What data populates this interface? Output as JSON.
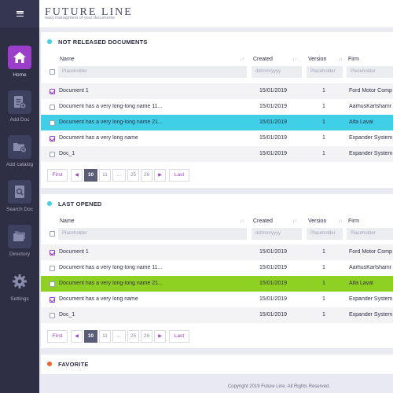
{
  "app": {
    "brand": "FUTURE LINE",
    "tagline": "easy managment of your documents"
  },
  "colors": {
    "sidebar": "#2e2f45",
    "accent": "#9b3ec9",
    "row_highlight_cyan": "#3fd0e8",
    "row_highlight_green": "#8fd123",
    "dot_cyan": "#3fd0e8",
    "dot_orange": "#f5622a"
  },
  "sidebar": {
    "menu_icon": "hamburger-icon",
    "items": [
      {
        "label": "Home",
        "icon": "home-icon",
        "active": true
      },
      {
        "label": "Add Doc",
        "icon": "add-document-icon",
        "active": false
      },
      {
        "label": "Add catalog",
        "icon": "add-folder-icon",
        "active": false
      },
      {
        "label": "Search Doc",
        "icon": "search-document-icon",
        "active": false
      },
      {
        "label": "Directory",
        "icon": "folders-icon",
        "active": false
      },
      {
        "label": "Settings",
        "icon": "gear-icon",
        "active": false
      }
    ]
  },
  "table_columns": {
    "name": "Name",
    "created": "Created",
    "version": "Version",
    "firm": "Firm",
    "sort_icon": "↓↑"
  },
  "filters": {
    "name": "Placeholder",
    "created": "dd/mm/yyyy",
    "version": "Placeholder",
    "firm": "Placeholder"
  },
  "not_released": {
    "title": "NOT RELEASED DOCUMENTS",
    "rows": [
      {
        "name": "Document 1",
        "created": "15/01/2019",
        "version": "1",
        "firm": "Ford Motor Comp",
        "checked": true
      },
      {
        "name": "Document has a very long-long name 11...",
        "created": "15/01/2019",
        "version": "1",
        "firm": "AarhusKarlshamr",
        "checked": false
      },
      {
        "name": "Document has a very long-long name 21...",
        "created": "15/01/2019",
        "version": "1",
        "firm": "Alfa Laval",
        "checked": false
      },
      {
        "name": "Document has a very long name",
        "created": "15/01/2019",
        "version": "1",
        "firm": "Expander System",
        "checked": true
      },
      {
        "name": "Doc_1",
        "created": "15/01/2019",
        "version": "1",
        "firm": "Expander System",
        "checked": false
      }
    ]
  },
  "last_opened": {
    "title": "LAST OPENED",
    "rows": [
      {
        "name": "Document 1",
        "created": "15/01/2019",
        "version": "1",
        "firm": "Ford Motor Comp",
        "checked": true
      },
      {
        "name": "Document has a very long-long name 11...",
        "created": "15/01/2019",
        "version": "1",
        "firm": "AarhusKarlshamr",
        "checked": false
      },
      {
        "name": "Document has a very long-long name 21...",
        "created": "15/01/2019",
        "version": "1",
        "firm": "Alfa Laval",
        "checked": false
      },
      {
        "name": "Document has a very long name",
        "created": "15/01/2019",
        "version": "1",
        "firm": "Expander System",
        "checked": true
      },
      {
        "name": "Doc_1",
        "created": "15/01/2019",
        "version": "1",
        "firm": "Expander System",
        "checked": false
      }
    ]
  },
  "pagination": {
    "first": "First",
    "prev": "◀",
    "current": "10",
    "next_page": "11",
    "ellipsis": "...",
    "p25": "25",
    "p26": "26",
    "next": "▶",
    "last": "Last"
  },
  "favorite": {
    "title": "FAVORITE"
  },
  "footer": {
    "copyright": "Copyright 2019 Future Line. All Rights Reserved."
  }
}
